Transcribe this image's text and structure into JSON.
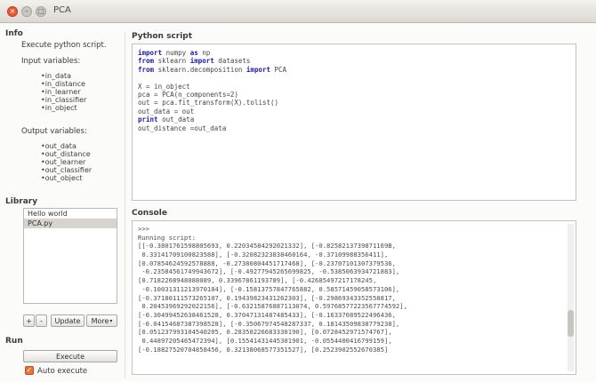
{
  "window": {
    "title": "PCA"
  },
  "info": {
    "heading": "Info",
    "description": "Execute python script.",
    "input_label": "Input variables:",
    "inputs": [
      "•in_data",
      "•in_distance",
      "•in_learner",
      "•in_classifier",
      "•in_object"
    ],
    "output_label": "Output variables:",
    "outputs": [
      "•out_data",
      "•out_distance",
      "•out_learner",
      "•out_classifier",
      "•out_object"
    ]
  },
  "library": {
    "heading": "Library",
    "items": [
      {
        "label": "Hello world",
        "selected": false
      },
      {
        "label": "PCA.py",
        "selected": true
      }
    ],
    "add_label": "+",
    "remove_label": "-",
    "update_label": "Update",
    "more_label": "More"
  },
  "run": {
    "heading": "Run",
    "execute_label": "Execute",
    "auto_execute_label": "Auto execute",
    "auto_execute_checked": true
  },
  "script": {
    "heading": "Python script",
    "lines": [
      [
        {
          "t": "import",
          "k": true
        },
        {
          "t": " numpy "
        },
        {
          "t": "as",
          "k": true
        },
        {
          "t": " np"
        }
      ],
      [
        {
          "t": "from",
          "k": true
        },
        {
          "t": " sklearn "
        },
        {
          "t": "import",
          "k": true
        },
        {
          "t": " datasets"
        }
      ],
      [
        {
          "t": "from",
          "k": true
        },
        {
          "t": " sklearn.decomposition "
        },
        {
          "t": "import",
          "k": true
        },
        {
          "t": " PCA"
        }
      ],
      [],
      [
        {
          "t": "X = in_object"
        }
      ],
      [
        {
          "t": "pca = PCA(n_components=2)"
        }
      ],
      [
        {
          "t": "out = pca.fit_transform(X).tolist()"
        }
      ],
      [
        {
          "t": "out_data = out"
        }
      ],
      [
        {
          "t": "print",
          "k": true
        },
        {
          "t": " out_data"
        }
      ],
      [
        {
          "t": "out_distance =out_data"
        }
      ]
    ]
  },
  "console": {
    "heading": "Console",
    "lines": [
      ">>>",
      "Running script:",
      "[[-0.3801761598805693, 0.22034584292021332], [-0.8258213739871169B,",
      " 0.33141709100823588], [-0.32082323838460164, -0.37109988356411],",
      "[0.07854624592578888, -0.27380804451717468], [-0.23707101307379536,",
      " -0.23584561749943672], [-0.49277945265699825, -0.5385063934721883],",
      "[0.7182268948088089, 0.33967861193789], [-0.42685497217178245,",
      " -0.10031311213970184], [-0.15813757847765882, 0.58571459058573106],",
      "[-0.37180111573265107, 0.19439823431262303], [-0.29869343352558817,",
      " 0.20453969292022156], [-0.63215876887113074, 0.59768577223567774592],",
      "[-0.30499452638461528, 0.37047131487485433], [-0.16337089522496436,",
      "[-0.04154687387398528], [-0.35067974548287337, 0.18143509838779238],",
      "[0.051237993104540205, 0.28350226683330190], [0.0728452971574767],",
      " 0.44897205465472394], [0.15541431445301901, -0.0554400416799159],",
      "[-0.18827520704858456, 0.32138068577351527], [0.2523902552670385]"
    ]
  }
}
